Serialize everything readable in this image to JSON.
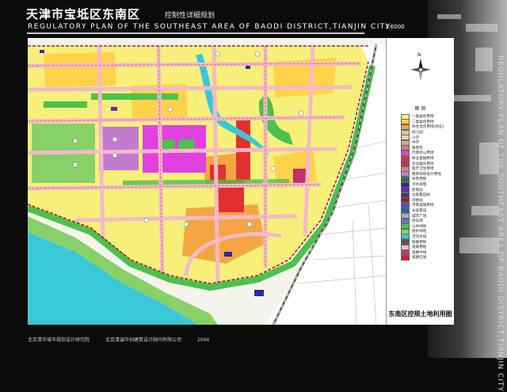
{
  "header": {
    "title_cn": "天津市宝坻区东南区",
    "subtitle_cn": "控制性详细规划",
    "title_en": "REGULATORY  PLAN  OF  THE  SOUTHEAST  AREA OF BAODI  DISTRICT,TIANJIN  CITY",
    "scale": "1:6000"
  },
  "side_text": "REGULATORY PLAN OF THE SOUTHEAST AREA OF BAODI DISTRICT,TIANJIN CITY",
  "north_label": "N",
  "legend": {
    "heading": "图 例",
    "title": "东南区控规土地利用图",
    "items": [
      {
        "label": "一类居住用地",
        "color": "#f6f07a"
      },
      {
        "label": "二类居住用地",
        "color": "#ffd24a"
      },
      {
        "label": "商住混合用地(商业)",
        "color": "#f5a640"
      },
      {
        "label": "幼儿园",
        "color": "#d4c7a0"
      },
      {
        "label": "小学",
        "color": "#e8d5b0"
      },
      {
        "label": "中学",
        "color": "#d9a8a0"
      },
      {
        "label": "敬老院",
        "color": "#c98080"
      },
      {
        "label": "行政办公用地",
        "color": "#e040e0"
      },
      {
        "label": "商业金融用地",
        "color": "#e23030"
      },
      {
        "label": "文化娱乐用地",
        "color": "#c0306a"
      },
      {
        "label": "医疗卫生用地",
        "color": "#e07f7f"
      },
      {
        "label": "教育科研设计用地",
        "color": "#c27bd0"
      },
      {
        "label": "体育用地",
        "color": "#2a7a3a"
      },
      {
        "label": "污水处理",
        "color": "#2a2aa0"
      },
      {
        "label": "变电站",
        "color": "#6a2ab0"
      },
      {
        "label": "垃圾集运站",
        "color": "#304070"
      },
      {
        "label": "消防站",
        "color": "#a02020"
      },
      {
        "label": "市政设施用地",
        "color": "#5050c0"
      },
      {
        "label": "长途客运",
        "color": "#3060a0"
      },
      {
        "label": "城市广场",
        "color": "#b0b0b0"
      },
      {
        "label": "停车场",
        "color": "#7070d0"
      },
      {
        "label": "公共绿地",
        "color": "#4bc24b"
      },
      {
        "label": "防护绿地",
        "color": "#88d068"
      },
      {
        "label": "河流水域",
        "color": "#38c8d8"
      },
      {
        "label": "铁路用地",
        "color": "#555555"
      },
      {
        "label": "道路用地",
        "color": "#f4b9c8"
      },
      {
        "label": "道路中线",
        "color": "#c04060"
      },
      {
        "label": "道路红线",
        "color": "#d02030"
      }
    ]
  },
  "footer": {
    "institute": "北京清华城市规划设计研究院",
    "company": "北京清诚华创建筑设计顾问有限公司",
    "year": "2004"
  }
}
